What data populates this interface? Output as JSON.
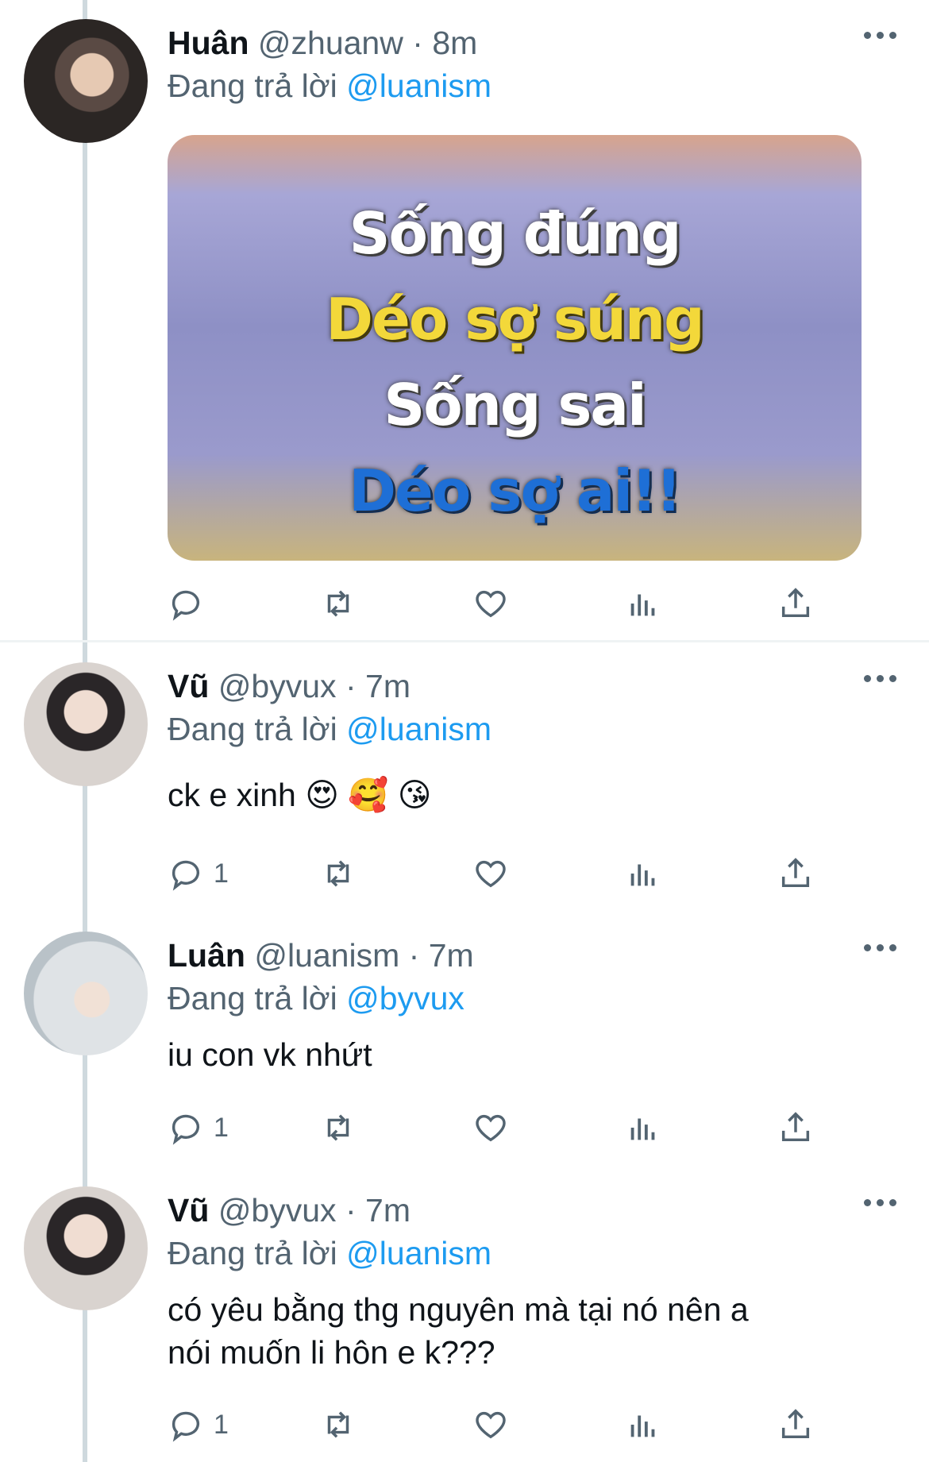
{
  "tweets": [
    {
      "name": "Huân",
      "handle": "@zhuanw",
      "time": "8m",
      "replying_prefix": "Đang trả lời",
      "replying_to": "@luanism",
      "media_text": [
        "Sống đúng",
        "Déo sợ súng",
        "Sống sai",
        "Déo sợ ai!!"
      ],
      "reply_count": ""
    },
    {
      "name": "Vũ",
      "handle": "@byvux",
      "time": "7m",
      "replying_prefix": "Đang trả lời",
      "replying_to": "@luanism",
      "text": "ck e xinh 😍 🥰 😘",
      "reply_count": "1"
    },
    {
      "name": "Luân",
      "handle": "@luanism",
      "time": "7m",
      "replying_prefix": "Đang trả lời",
      "replying_to": "@byvux",
      "text": "iu con vk nhứt",
      "reply_count": "1"
    },
    {
      "name": "Vũ",
      "handle": "@byvux",
      "time": "7m",
      "replying_prefix": "Đang trả lời",
      "replying_to": "@luanism",
      "text_line1": "có yêu bằng thg nguyên mà tại nó nên a",
      "text_line2": "nói muốn li hôn e k???",
      "reply_count": "1"
    }
  ],
  "separator": "·",
  "icons": [
    "reply-icon",
    "retweet-icon",
    "like-icon",
    "analytics-icon",
    "share-icon",
    "more-icon"
  ],
  "colors": {
    "link": "#1d9bf0",
    "secondary": "#536471",
    "text": "#0f1419"
  }
}
